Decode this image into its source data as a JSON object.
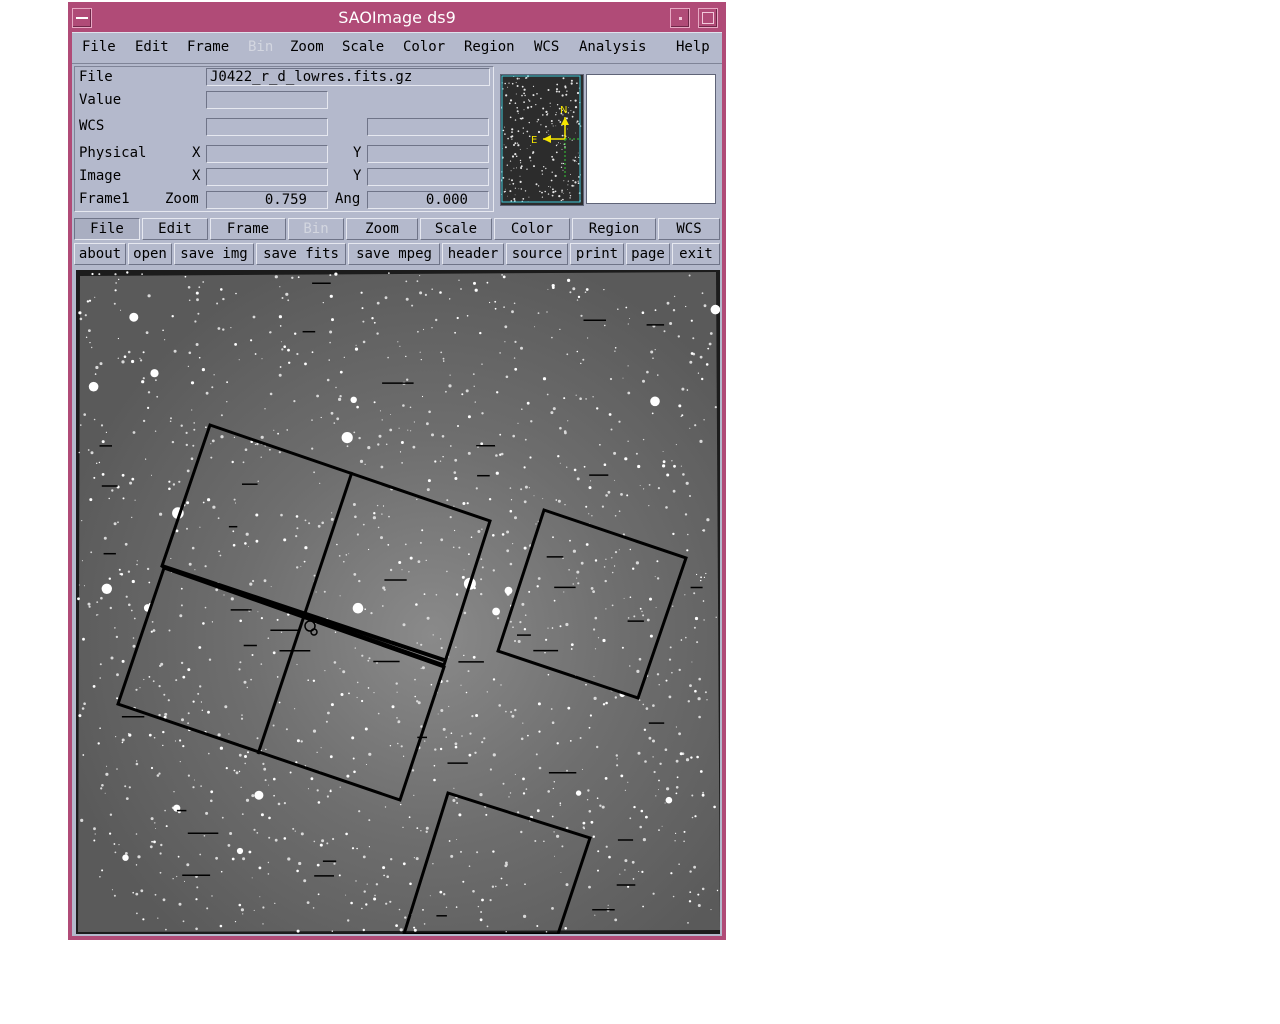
{
  "window": {
    "title": "SAOImage ds9"
  },
  "menubar": [
    "File",
    "Edit",
    "Frame",
    "Bin",
    "Zoom",
    "Scale",
    "Color",
    "Region",
    "WCS",
    "Analysis",
    "Help"
  ],
  "menubar_disabled": [
    "Bin"
  ],
  "info": {
    "file_label": "File",
    "file_value": "J0422_r_d_lowres.fits.gz",
    "value_label": "Value",
    "value_value": "",
    "wcs_label": "WCS",
    "wcs_value1": "",
    "wcs_value2": "",
    "physical_label": "Physical",
    "physical_x_label": "X",
    "physical_x": "",
    "physical_y_label": "Y",
    "physical_y": "",
    "image_label": "Image",
    "image_x_label": "X",
    "image_x": "",
    "image_y_label": "Y",
    "image_y": "",
    "frame_label": "Frame1",
    "zoom_label": "Zoom",
    "zoom_value": "0.759",
    "ang_label": "Ang",
    "ang_value": "0.000"
  },
  "panner": {
    "north_label": "N",
    "east_label": "E",
    "compass_color": "#f5e600",
    "axes_color": "#33cc33"
  },
  "button_bar_major": [
    "File",
    "Edit",
    "Frame",
    "Bin",
    "Zoom",
    "Scale",
    "Color",
    "Region",
    "WCS"
  ],
  "button_bar_major_selected": "File",
  "button_bar_major_disabled": [
    "Bin"
  ],
  "button_bar_minor": [
    "about",
    "open",
    "save img",
    "save fits",
    "save mpeg",
    "header",
    "source",
    "print",
    "page",
    "exit"
  ],
  "colors": {
    "title_bar": "#b04b77",
    "panel_bg": "#b4b9cc",
    "region_color": "#000000"
  }
}
